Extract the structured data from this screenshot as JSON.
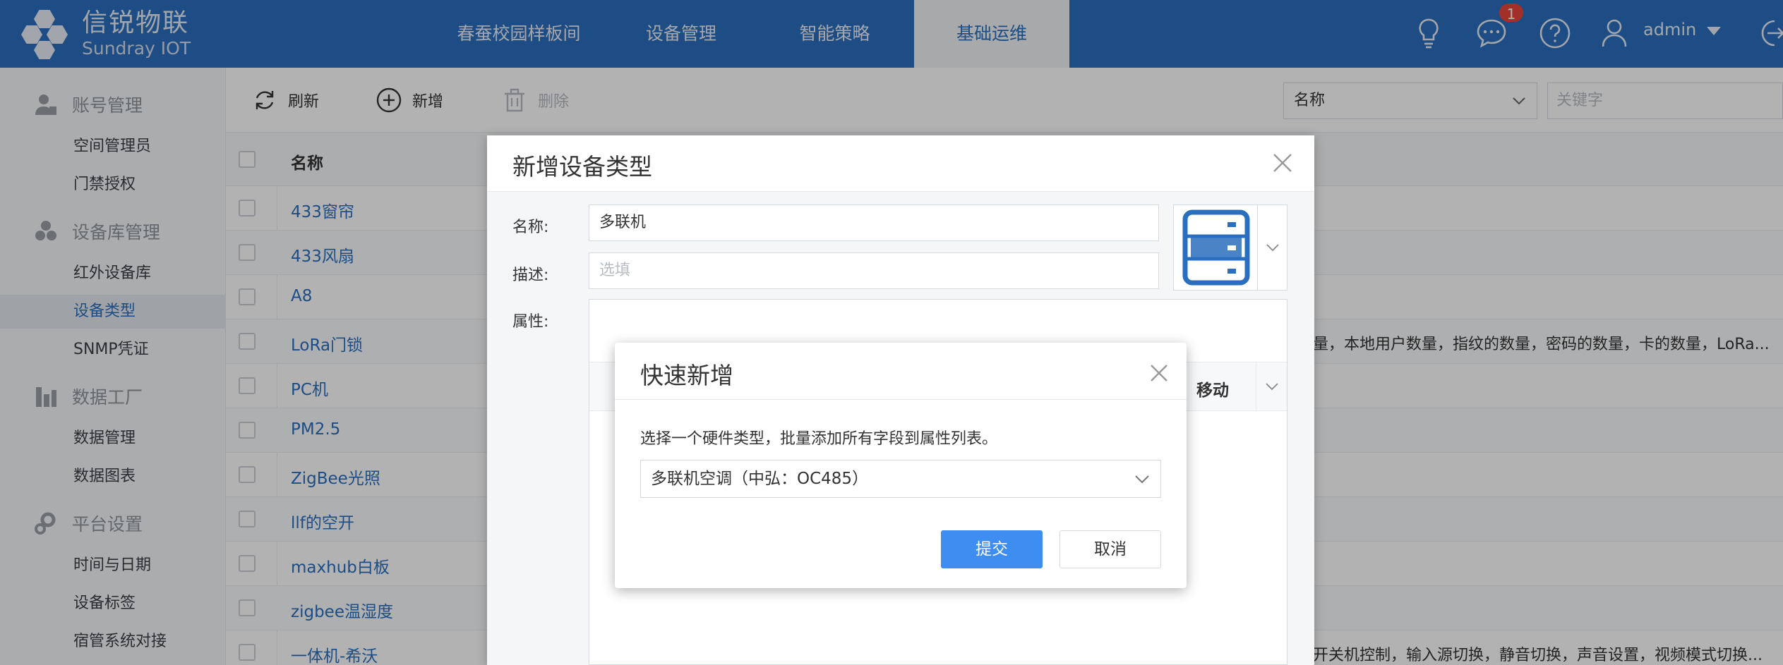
{
  "app": {
    "logo_cn": "信锐物联",
    "logo_en": "Sundray IOT",
    "brand_color": "#2a6fbd"
  },
  "nav": {
    "items": [
      {
        "label": "春蚕校园样板间"
      },
      {
        "label": "设备管理"
      },
      {
        "label": "智能策略"
      },
      {
        "label": "基础运维"
      }
    ],
    "active_index": 3
  },
  "header": {
    "message_count": "1",
    "user": "admin",
    "icons": [
      "lightbulb-icon",
      "chat-icon",
      "help-icon",
      "user-icon",
      "chevron-down-icon",
      "logout-icon"
    ]
  },
  "sidebar": {
    "groups": [
      {
        "label": "账号管理",
        "icon": "account-icon",
        "items": [
          "空间管理员",
          "门禁授权"
        ]
      },
      {
        "label": "设备库管理",
        "icon": "device-library-icon",
        "items": [
          "红外设备库",
          "设备类型",
          "SNMP凭证"
        ]
      },
      {
        "label": "数据工厂",
        "icon": "data-factory-icon",
        "items": [
          "数据管理",
          "数据图表"
        ]
      },
      {
        "label": "平台设置",
        "icon": "settings-icon",
        "items": [
          "时间与日期",
          "设备标签",
          "宿管系统对接"
        ]
      }
    ],
    "active_item": "设备类型"
  },
  "toolbar": {
    "refresh": "刷新",
    "add": "新增",
    "delete": "删除",
    "filter_select": "名称",
    "search_placeholder": "关键字"
  },
  "table": {
    "column_name": "名称",
    "rows": [
      {
        "name": "433窗帘",
        "extra": ""
      },
      {
        "name": "433风扇",
        "extra": ""
      },
      {
        "name": "A8",
        "extra": ""
      },
      {
        "name": "LoRa门锁",
        "extra": "量，本地用户数量，指纹的数量，密码的数量，卡的数量，LoRa..."
      },
      {
        "name": "PC机",
        "extra": ""
      },
      {
        "name": "PM2.5",
        "extra": ""
      },
      {
        "name": "ZigBee光照",
        "extra": ""
      },
      {
        "name": "llf的空开",
        "extra": ""
      },
      {
        "name": "maxhub白板",
        "extra": ""
      },
      {
        "name": "zigbee温湿度",
        "extra": ""
      },
      {
        "name": "一体机-希沃",
        "extra": "开关机控制，输入源切换，静音切换，声音设置，视频模式切换..."
      }
    ]
  },
  "dialog_add_type": {
    "title": "新增设备类型",
    "name_label": "名称:",
    "name_value": "多联机",
    "desc_label": "描述:",
    "desc_placeholder": "选填",
    "attr_label": "属性:",
    "attr_col_move": "移动",
    "selected_icon": "server-icon"
  },
  "dialog_quick_add": {
    "title": "快速新增",
    "description": "选择一个硬件类型，批量添加所有字段到属性列表。",
    "selected_hardware": "多联机空调（中弘：OC485）",
    "submit": "提交",
    "cancel": "取消",
    "submit_color": "#3d8ef0"
  }
}
